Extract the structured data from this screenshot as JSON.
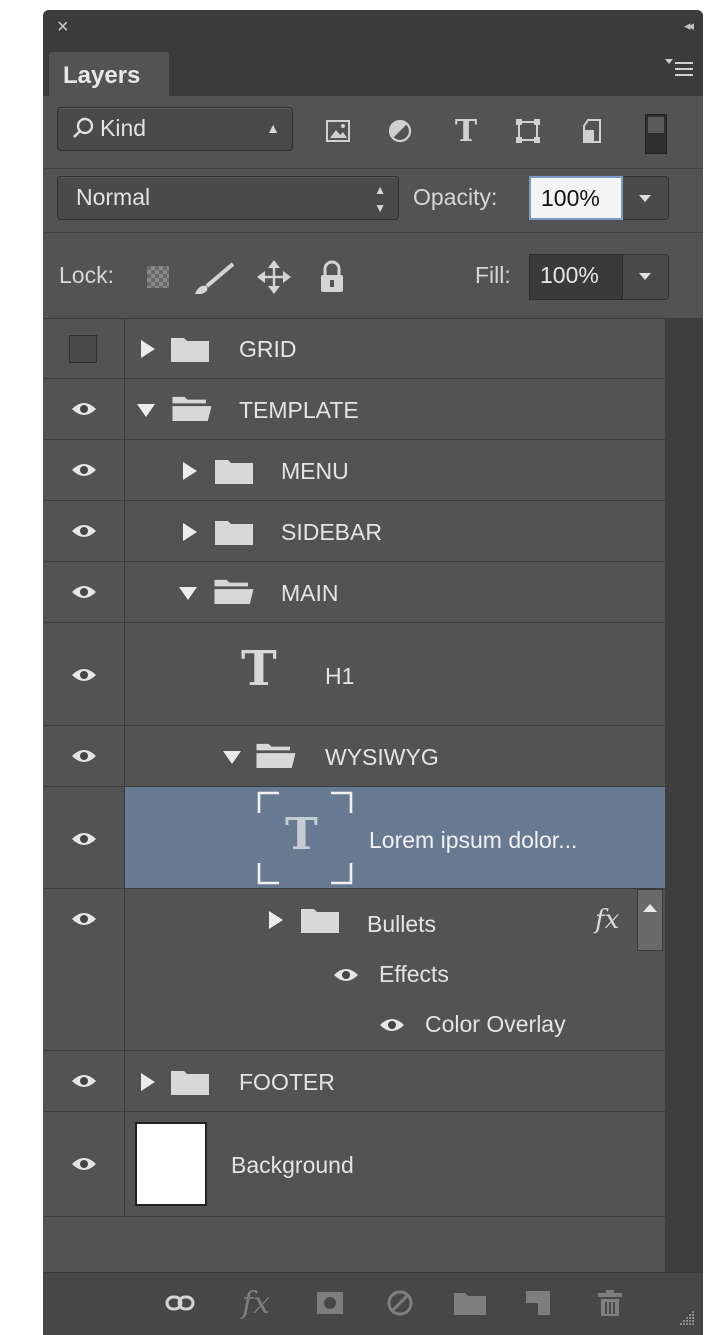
{
  "panel": {
    "close_glyph": "×",
    "collapse_glyph": "◂◂",
    "tab_label": "Layers",
    "menu_icon": "panel-menu-icon"
  },
  "filter": {
    "kind_label": "Kind",
    "icons": [
      "pixel-filter-icon",
      "adjustment-filter-icon",
      "type-filter-icon",
      "shape-filter-icon",
      "smart-object-filter-icon",
      "filter-toggle-switch"
    ]
  },
  "blend": {
    "mode": "Normal",
    "opacity_label": "Opacity:",
    "opacity_value": "100%"
  },
  "lock": {
    "label": "Lock:",
    "icons": [
      "lock-transparent-icon",
      "lock-brush-icon",
      "lock-move-icon",
      "lock-all-icon"
    ],
    "fill_label": "Fill:",
    "fill_value": "100%"
  },
  "layers": [
    {
      "name": "GRID",
      "type": "group",
      "expanded": false,
      "visible": false,
      "depth": 0
    },
    {
      "name": "TEMPLATE",
      "type": "group",
      "expanded": true,
      "visible": true,
      "depth": 0
    },
    {
      "name": "MENU",
      "type": "group",
      "expanded": false,
      "visible": true,
      "depth": 1
    },
    {
      "name": "SIDEBAR",
      "type": "group",
      "expanded": false,
      "visible": true,
      "depth": 1
    },
    {
      "name": "MAIN",
      "type": "group",
      "expanded": true,
      "visible": true,
      "depth": 1
    },
    {
      "name": "H1",
      "type": "text",
      "visible": true,
      "depth": 2
    },
    {
      "name": "WYSIWYG",
      "type": "group",
      "expanded": true,
      "visible": true,
      "depth": 2
    },
    {
      "name": "Lorem ipsum dolor...",
      "type": "text",
      "visible": true,
      "depth": 3,
      "selected": true
    },
    {
      "name": "Bullets",
      "type": "group",
      "expanded": false,
      "visible": true,
      "depth": 3,
      "fx": "fx",
      "effects_label": "Effects",
      "effect_item": "Color Overlay"
    },
    {
      "name": "FOOTER",
      "type": "group",
      "expanded": false,
      "visible": true,
      "depth": 0
    },
    {
      "name": "Background",
      "type": "image",
      "visible": true,
      "depth": 0
    }
  ],
  "footer": {
    "icons": [
      "link-layers-icon",
      "add-style-icon",
      "add-mask-icon",
      "new-adjustment-icon",
      "new-group-icon",
      "new-layer-icon",
      "delete-layer-icon"
    ]
  },
  "colors": {
    "panel_bg": "#535353",
    "selected_row": "#677a91",
    "titlebar": "#3b3b3b"
  }
}
